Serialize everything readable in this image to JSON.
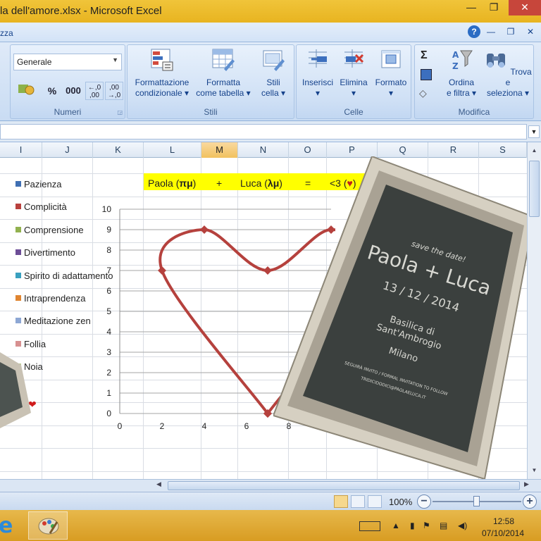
{
  "window": {
    "title": "la dell'amore.xlsx - Microsoft Excel",
    "controls": {
      "minimize": "—",
      "restore": "❐",
      "close": "✕"
    }
  },
  "ribbon": {
    "partial_tab": "zza",
    "help": "?",
    "number_format": "Generale",
    "groups": {
      "numeri": "Numeri",
      "stili": "Stili",
      "celle": "Celle",
      "modifica": "Modifica"
    },
    "buttons": {
      "formattazione_condizionale": [
        "Formattazione",
        "condizionale ▾"
      ],
      "formatta_come_tabella": [
        "Formatta",
        "come tabella ▾"
      ],
      "stili_cella": [
        "Stili",
        "cella ▾"
      ],
      "inserisci": [
        "Inserisci",
        "▾"
      ],
      "elimina": [
        "Elimina",
        "▾"
      ],
      "formato": [
        "Formato",
        "▾"
      ],
      "ordina_filtra": [
        "Ordina",
        "e filtra ▾"
      ],
      "trova_seleziona": [
        "Trova e",
        "seleziona ▾"
      ]
    },
    "small": {
      "percent": "%",
      "thousands": "000",
      "inc_dec": "←,0\n,00",
      "dec_dec": ",00\n→,0",
      "sum": "Σ"
    }
  },
  "columns": [
    "I",
    "J",
    "K",
    "L",
    "M",
    "N",
    "O",
    "P",
    "Q",
    "R",
    "S"
  ],
  "selected_column": "M",
  "equation": {
    "left": "Paola (",
    "left_sym": "πμ",
    "right_paren1": ")",
    "plus": "+",
    "right": "Luca (",
    "right_sym": "λμ",
    "right_paren2": ")",
    "equals": "=",
    "result_pre": "<3 (",
    "heart": "♥",
    "result_post": ")"
  },
  "legend": [
    {
      "label": "Pazienza",
      "color": "#3f6fb3"
    },
    {
      "label": "Complicità",
      "color": "#b9413e"
    },
    {
      "label": "Comprensione",
      "color": "#92b14f"
    },
    {
      "label": "Divertimento",
      "color": "#6d4e97"
    },
    {
      "label": "Spirito di adattamento",
      "color": "#3aa0bf"
    },
    {
      "label": "Intraprendenza",
      "color": "#e08531"
    },
    {
      "label": "Meditazione zen",
      "color": "#8da7d4"
    },
    {
      "label": "Follia",
      "color": "#d79090"
    },
    {
      "label": "Noia",
      "color": "#b6cd8c"
    }
  ],
  "heart_marker": "❤",
  "chart_data": {
    "type": "scatter",
    "title": "",
    "xlabel": "",
    "ylabel": "",
    "xlim": [
      0,
      10
    ],
    "ylim": [
      0,
      10
    ],
    "x_ticks": [
      0,
      2,
      4,
      6,
      8
    ],
    "y_ticks": [
      0,
      1,
      2,
      3,
      4,
      5,
      6,
      7,
      8,
      9,
      10
    ],
    "grid": true,
    "series": [
      {
        "color": "#b5413d",
        "x": [
          7,
          2,
          4,
          7,
          10,
          12,
          7
        ],
        "y": [
          0,
          7,
          9,
          7,
          9,
          7,
          0
        ]
      }
    ]
  },
  "invitation": {
    "line1": "save the date!",
    "line2": "Paola + Luca",
    "line3": "13 / 12 / 2014",
    "line4": "Basilica di",
    "line5": "Sant'Ambrogio",
    "line6": "Milano",
    "line7": "SEGUIRÀ INVITO / FORMAL INVITATION TO FOLLOW",
    "line8": "TRIDICIDODICI@PAOLAELUCA.IT"
  },
  "status": {
    "zoom": "100%",
    "minus": "−",
    "plus": "+"
  },
  "taskbar": {
    "time": "12:58",
    "date": "07/10/2014"
  }
}
